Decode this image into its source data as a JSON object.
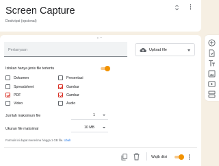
{
  "form": {
    "title": "Screen Capture",
    "description_placeholder": "Deskripsi (opsional)"
  },
  "question": {
    "placeholder": "Pertanyaan",
    "type_label": "Upload file",
    "type_icon": "cloud-upload-icon"
  },
  "file_types": {
    "label": "Izinkan hanya jenis file tertentu",
    "toggle_on": true,
    "options": [
      {
        "label": "Dokumen",
        "checked": false
      },
      {
        "label": "Presentasi",
        "checked": false
      },
      {
        "label": "Spreadsheet",
        "checked": false
      },
      {
        "label": "Gambar",
        "checked": true
      },
      {
        "label": "PDF",
        "checked": true
      },
      {
        "label": "Gambar",
        "checked": true
      },
      {
        "label": "Video",
        "checked": false
      },
      {
        "label": "Audio",
        "checked": false
      }
    ]
  },
  "max_files": {
    "label": "Jumlah maksimum file",
    "value": "1"
  },
  "max_size": {
    "label": "Ukuran file maksimal",
    "value": "10 MB"
  },
  "note": {
    "text": "Formulir ini dapat menerima hingga 1 GB file.",
    "link": "Ubah"
  },
  "footer": {
    "required_label": "Wajib diisi",
    "required_on": true
  },
  "colors": {
    "accent": "#f29200",
    "checkbox_checked": "#d93025",
    "background": "#f6efe3",
    "link": "#1a73e8"
  },
  "toolbar_icons": [
    "add-question-icon",
    "import-questions-icon",
    "add-title-icon",
    "add-image-icon",
    "add-video-icon",
    "add-section-icon"
  ]
}
